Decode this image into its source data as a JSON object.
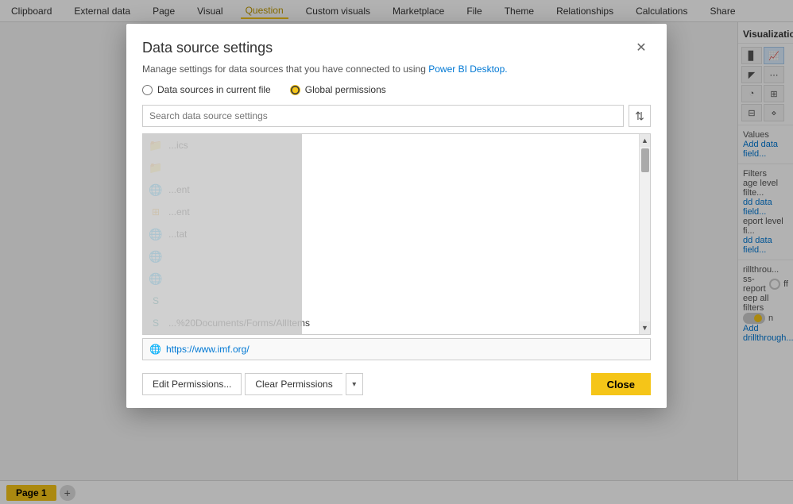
{
  "ribbon": {
    "items": [
      "Clipboard",
      "External data",
      "Page",
      "Visual",
      "Question",
      "Custom visuals",
      "Marketplace",
      "File",
      "Theme",
      "Relationships",
      "Calculations",
      "Share"
    ]
  },
  "modal": {
    "title": "Data source settings",
    "subtitle": "Manage settings for data sources that you have connected to using Power BI Desktop.",
    "subtitle_link": "Power BI Desktop.",
    "close_label": "✕",
    "radio_current_file": "Data sources in current file",
    "radio_global": "Global permissions",
    "search_placeholder": "Search data source settings",
    "sort_icon": "≡",
    "datasources": [
      {
        "icon": "folder",
        "text": "...ics",
        "selected": false
      },
      {
        "icon": "folder",
        "text": "",
        "selected": false
      },
      {
        "icon": "globe",
        "text": "...ent",
        "selected": false
      },
      {
        "icon": "table",
        "text": "...ent",
        "selected": false
      },
      {
        "icon": "globe",
        "text": "...tat",
        "selected": false
      },
      {
        "icon": "globe",
        "text": "",
        "selected": false
      },
      {
        "icon": "globe",
        "text": "",
        "selected": false
      },
      {
        "icon": "sharepoint",
        "text": "",
        "selected": false
      },
      {
        "icon": "sharepoint",
        "text": "...%20Documents/Forms/AllItems",
        "selected": false
      }
    ],
    "selected_url": "https://www.imf.org/",
    "selected_url_icon": "🌐",
    "btn_edit_permissions": "Edit Permissions...",
    "btn_clear_permissions": "Clear Permissions",
    "btn_clear_dropdown_icon": "▾",
    "btn_close": "Close"
  },
  "right_panel": {
    "title": "Visualization",
    "sections": {
      "values_label": "Values",
      "add_data_field": "Add data field...",
      "filters_label": "Filters",
      "page_level_filter": "age level filte...",
      "add_data_field2": "dd data field...",
      "report_level": "eport level fi...",
      "add_data_field3": "dd data field...",
      "drillthrough_label": "rillthrou...",
      "cross_report": "ss-report",
      "off_label": "ff",
      "keep_all_filters": "eep all filters",
      "on_label": "n",
      "add_drillthrough": "Add drillthrough..."
    }
  },
  "bottom_bar": {
    "page_tab": "Page 1",
    "add_page_icon": "+"
  }
}
